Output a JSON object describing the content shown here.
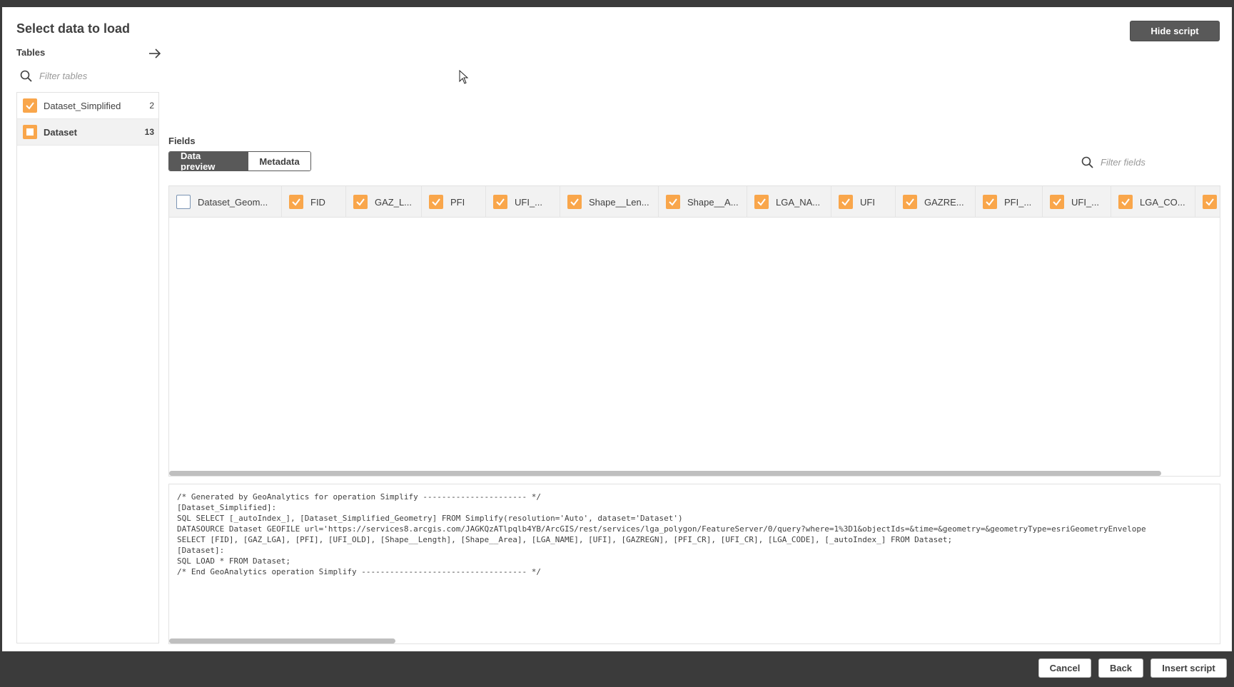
{
  "dialog": {
    "title": "Select data to load",
    "hide_script_label": "Hide script"
  },
  "tables": {
    "label": "Tables",
    "filter_placeholder": "Filter tables",
    "items": [
      {
        "name": "Dataset_Simplified",
        "count": "2",
        "state": "checked"
      },
      {
        "name": "Dataset",
        "count": "13",
        "state": "partial"
      }
    ]
  },
  "fields": {
    "label": "Fields",
    "tabs": [
      {
        "label": "Data preview",
        "active": true
      },
      {
        "label": "Metadata",
        "active": false
      }
    ],
    "filter_placeholder": "Filter fields",
    "columns": [
      {
        "label": "Dataset_Geom...",
        "checked": false
      },
      {
        "label": "FID",
        "checked": true
      },
      {
        "label": "GAZ_L...",
        "checked": true
      },
      {
        "label": "PFI",
        "checked": true
      },
      {
        "label": "UFI_...",
        "checked": true
      },
      {
        "label": "Shape__Len...",
        "checked": true
      },
      {
        "label": "Shape__A...",
        "checked": true
      },
      {
        "label": "LGA_NA...",
        "checked": true
      },
      {
        "label": "UFI",
        "checked": true
      },
      {
        "label": "GAZRE...",
        "checked": true
      },
      {
        "label": "PFI_...",
        "checked": true
      },
      {
        "label": "UFI_...",
        "checked": true
      },
      {
        "label": "LGA_CO...",
        "checked": true
      },
      {
        "label": "",
        "checked": true
      }
    ]
  },
  "script": {
    "lines": [
      "/* Generated by GeoAnalytics for operation Simplify ---------------------- */",
      "[Dataset_Simplified]:",
      "SQL SELECT [_autoIndex_], [Dataset_Simplified_Geometry] FROM Simplify(resolution='Auto', dataset='Dataset')",
      "DATASOURCE Dataset GEOFILE url='https://services8.arcgis.com/JAGKQzATlpqlb4YB/ArcGIS/rest/services/lga_polygon/FeatureServer/0/query?where=1%3D1&objectIds=&time=&geometry=&geometryType=esriGeometryEnvelope",
      "SELECT [FID], [GAZ_LGA], [PFI], [UFI_OLD], [Shape__Length], [Shape__Area], [LGA_NAME], [UFI], [GAZREGN], [PFI_CR], [UFI_CR], [LGA_CODE], [_autoIndex_] FROM Dataset;",
      "[Dataset]:",
      "SQL LOAD * FROM Dataset;",
      "/* End GeoAnalytics operation Simplify ----------------------------------- */"
    ]
  },
  "footer": {
    "cancel_label": "Cancel",
    "back_label": "Back",
    "insert_label": "Insert script"
  },
  "colors": {
    "accent": "#f9a64b",
    "dark": "#595959",
    "frame": "#3b3b3b"
  }
}
